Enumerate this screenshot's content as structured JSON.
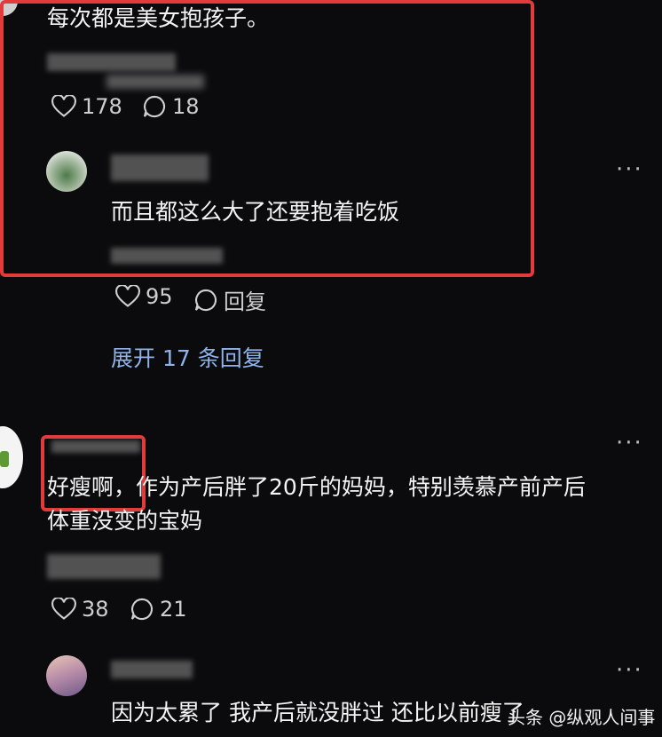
{
  "comment1": {
    "text": "每次都是美女抱孩子。",
    "likes": "178",
    "replies": "18"
  },
  "reply1": {
    "text": "而且都这么大了还要抱着吃饭",
    "likes": "95",
    "reply_label": "回复"
  },
  "expand_label": "展开 17 条回复",
  "comment2": {
    "text_highlight": "好瘦啊，",
    "text_rest": "作为产后胖了20斤的妈妈，特别羡慕产前产后",
    "text_line2": "体重没变的宝妈",
    "likes": "38",
    "replies": "21"
  },
  "reply2": {
    "text": "因为太累了 我产后就没胖过 还比以前瘦了"
  },
  "more_label": "···",
  "watermark": "头条 @纵观人间事",
  "colors": {
    "highlight_box": "#e23b3b",
    "link": "#8fb3e8",
    "background": "#0b0b0d"
  }
}
